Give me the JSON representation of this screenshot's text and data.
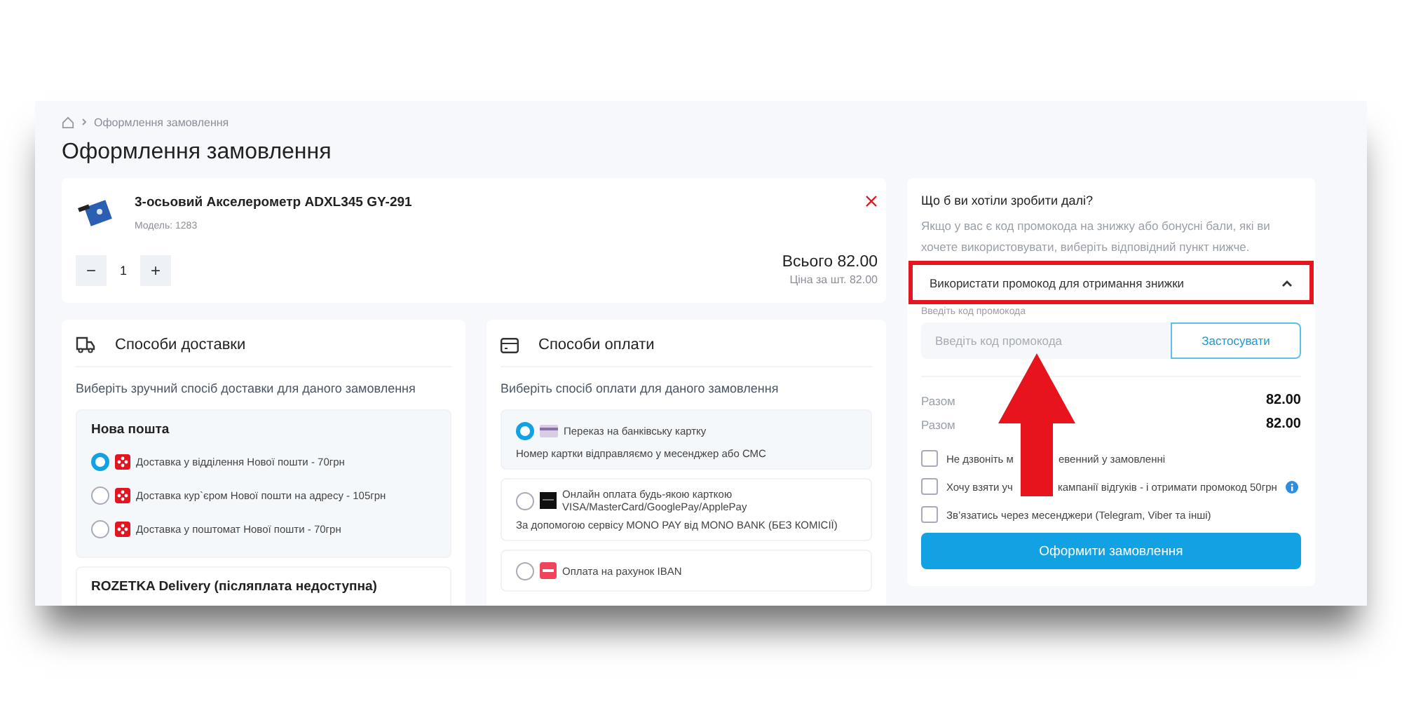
{
  "breadcrumb": {
    "current": "Оформлення замовлення"
  },
  "title": "Оформлення замовлення",
  "product": {
    "name": "3-осьовий Акселерометр ADXL345 GY-291",
    "model": "Модель: 1283",
    "quantity": "1",
    "minus": "−",
    "plus": "+",
    "total": "Всього 82.00",
    "unit_price": "Ціна за шт. 82.00"
  },
  "delivery": {
    "title": "Способи доставки",
    "subtitle": "Виберіть зручний спосіб доставки для даного замовлення",
    "groups": [
      {
        "name": "Нова пошта",
        "options": [
          {
            "label": "Доставка у відділення Нової пошти - 70грн",
            "selected": true
          },
          {
            "label": "Доставка кур`єром Нової пошти на адресу - 105грн",
            "selected": false
          },
          {
            "label": "Доставка у поштомат Нової пошти - 70грн",
            "selected": false
          }
        ]
      },
      {
        "name": "ROZETKA Delivery (післяплата недоступна)"
      }
    ]
  },
  "payment": {
    "title": "Способи оплати",
    "subtitle": "Виберіть спосіб оплати для даного замовлення",
    "options": [
      {
        "kind": "card",
        "label": "Переказ на банківську картку",
        "note": "Номер картки відправляємо у месенджер або СМС",
        "selected": true
      },
      {
        "kind": "mono",
        "label": "Онлайн оплата будь-якою карткою VISA/MasterCard/GooglePay/ApplePay",
        "note": "За допомогою сервісу MONO PAY від MONO BANK (БЕЗ КОМІСІЇ)",
        "selected": false
      },
      {
        "kind": "iban",
        "label": "Оплата на рахунок IBAN",
        "selected": false
      }
    ]
  },
  "summary": {
    "question": "Що б ви хотіли зробити далі?",
    "hint": "Якщо у вас є код промокода на знижку або бонусні бали, які ви хочете використовувати, виберіть відповідний пункт нижче.",
    "promo": {
      "label": "Використати промокод для отримання знижки",
      "expanded": true,
      "highlighted": true,
      "field_label": "Введіть код промокода",
      "placeholder": "Введіть код промокода",
      "button": "Застосувати"
    },
    "totals": [
      {
        "label": "Разом",
        "value": "82.00"
      },
      {
        "label": "Разом",
        "value": "82.00"
      }
    ],
    "checkboxes": [
      {
        "label": "Не дзвоніть м",
        "label_end": "евенний у замовленні",
        "checked": false,
        "info": false
      },
      {
        "label": "Хочу взяти уч",
        "label_end": "кампанії відгуків - і отримати промокод 50грн",
        "checked": false,
        "info": true
      },
      {
        "label": "Зв’язатись через месенджери (Telegram, Viber та інші)",
        "checked": false,
        "info": false
      }
    ],
    "submit": "Оформити замовлення"
  },
  "annotation": {
    "arrow": true
  }
}
